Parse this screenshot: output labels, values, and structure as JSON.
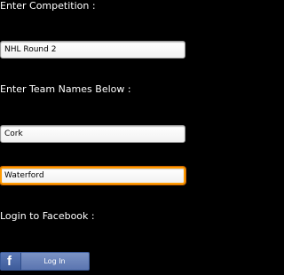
{
  "competition": {
    "label": "Enter Competition :",
    "value": "NHL Round 2"
  },
  "teams": {
    "label": "Enter Team Names Below :",
    "team1": "Cork",
    "team2": "Waterford"
  },
  "facebook": {
    "label": "Login to Facebook :",
    "logo": "f",
    "button_label": "Log In",
    "logo_icon": "facebook-f-icon"
  },
  "colors": {
    "background": "#000000",
    "focus_border": "#ff9a00",
    "facebook_blue": "#5b75b0"
  }
}
